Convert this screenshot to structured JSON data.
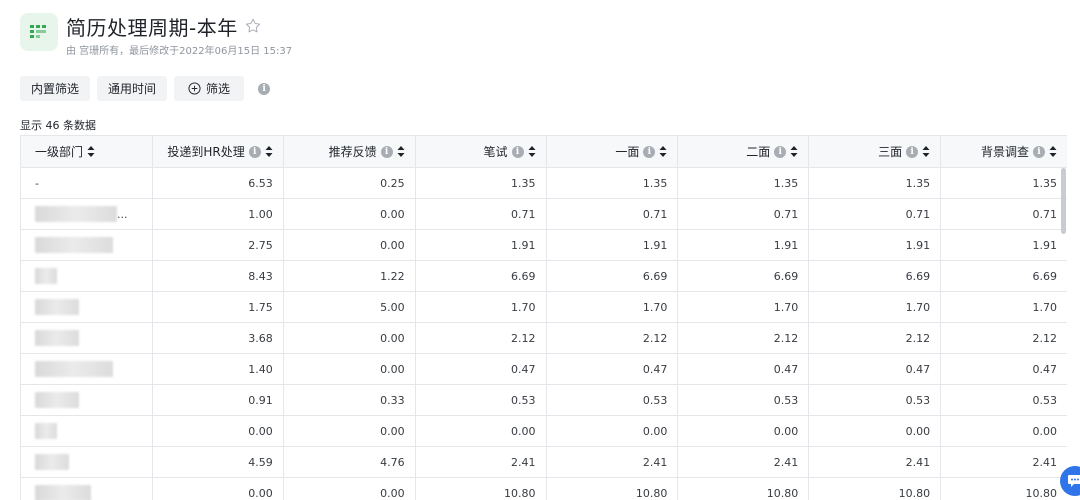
{
  "header": {
    "title": "简历处理周期-本年",
    "subtitle": "由 宫珊所有，最后修改于2022年06月15日 15:37",
    "icon": "table-grid-icon",
    "accent_color": "#34a853"
  },
  "toolbar": {
    "builtin_filter_label": "内置筛选",
    "common_time_label": "通用时间",
    "filter_label": "筛选"
  },
  "result_count_text": "显示 46 条数据",
  "table": {
    "columns": [
      "一级部门",
      "投递到HR处理",
      "推荐反馈",
      "笔试",
      "一面",
      "二面",
      "三面",
      "背景调查"
    ],
    "rows": [
      {
        "dept": "-",
        "values": [
          "6.53",
          "0.25",
          "1.35",
          "1.35",
          "1.35",
          "1.35",
          "1.35"
        ]
      },
      {
        "dept": "...",
        "values": [
          "1.00",
          "0.00",
          "0.71",
          "0.71",
          "0.71",
          "0.71",
          "0.71"
        ]
      },
      {
        "dept": "",
        "values": [
          "2.75",
          "0.00",
          "1.91",
          "1.91",
          "1.91",
          "1.91",
          "1.91"
        ]
      },
      {
        "dept": "",
        "values": [
          "8.43",
          "1.22",
          "6.69",
          "6.69",
          "6.69",
          "6.69",
          "6.69"
        ]
      },
      {
        "dept": "",
        "values": [
          "1.75",
          "5.00",
          "1.70",
          "1.70",
          "1.70",
          "1.70",
          "1.70"
        ]
      },
      {
        "dept": "",
        "values": [
          "3.68",
          "0.00",
          "2.12",
          "2.12",
          "2.12",
          "2.12",
          "2.12"
        ]
      },
      {
        "dept": "",
        "values": [
          "1.40",
          "0.00",
          "0.47",
          "0.47",
          "0.47",
          "0.47",
          "0.47"
        ]
      },
      {
        "dept": "",
        "values": [
          "0.91",
          "0.33",
          "0.53",
          "0.53",
          "0.53",
          "0.53",
          "0.53"
        ]
      },
      {
        "dept": "",
        "values": [
          "0.00",
          "0.00",
          "0.00",
          "0.00",
          "0.00",
          "0.00",
          "0.00"
        ]
      },
      {
        "dept": "",
        "values": [
          "4.59",
          "4.76",
          "2.41",
          "2.41",
          "2.41",
          "2.41",
          "2.41"
        ]
      },
      {
        "dept": "",
        "values": [
          "0.00",
          "0.00",
          "10.80",
          "10.80",
          "10.80",
          "10.80",
          "10.80"
        ]
      }
    ]
  }
}
